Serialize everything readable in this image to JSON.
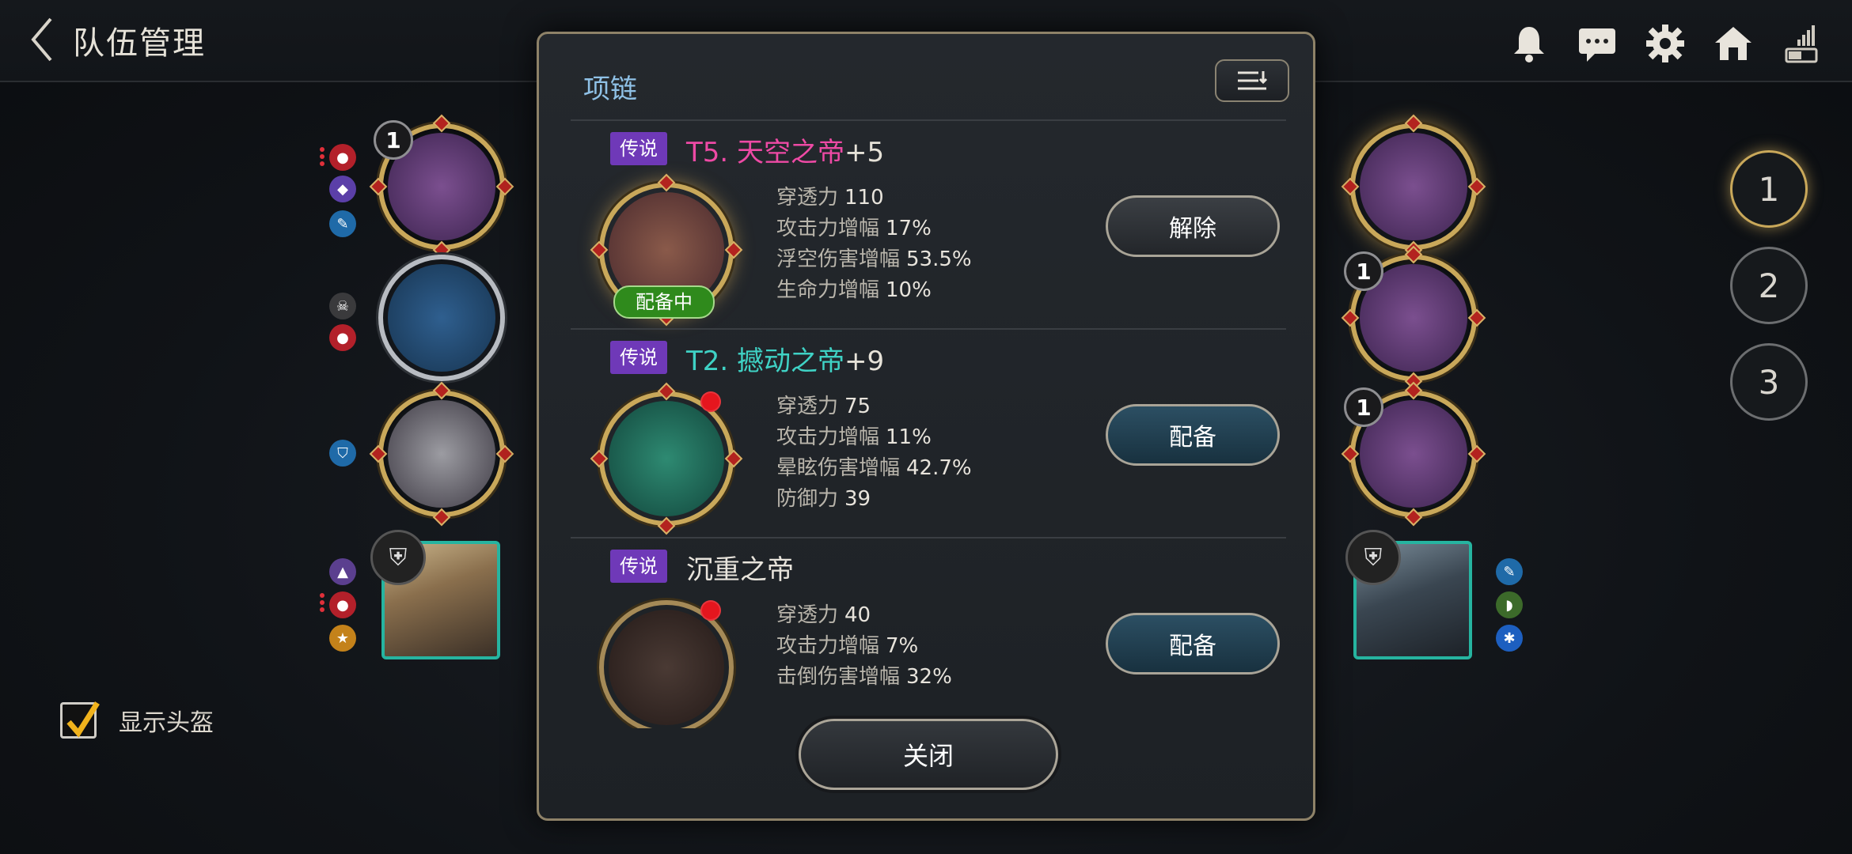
{
  "header": {
    "title": "队伍管理"
  },
  "left_heroes": {
    "slot1_count": "1"
  },
  "right_heroes": {
    "slot2_count": "1",
    "slot3_count": "1"
  },
  "page_tabs": [
    "1",
    "2",
    "3"
  ],
  "show_helmet": {
    "label": "显示头盔",
    "checked": true
  },
  "modal": {
    "title": "项链",
    "items": [
      {
        "rarity": "传说",
        "name": "T5. 天空之帝",
        "plus": "+5",
        "name_color": "#ee4aa5",
        "equipped_tag": "配备中",
        "stats": [
          {
            "label": "穿透力",
            "value": "110"
          },
          {
            "label": "攻击力增幅",
            "value": "17%"
          },
          {
            "label": "浮空伤害增幅",
            "value": "53.5%"
          },
          {
            "label": "生命力增幅",
            "value": "10%"
          }
        ],
        "action": "解除"
      },
      {
        "rarity": "传说",
        "name": "T2. 撼动之帝",
        "plus": "+9",
        "name_color": "#3fd2c5",
        "stats": [
          {
            "label": "穿透力",
            "value": "75"
          },
          {
            "label": "攻击力增幅",
            "value": "11%"
          },
          {
            "label": "晕眩伤害增幅",
            "value": "42.7%"
          },
          {
            "label": "防御力",
            "value": "39"
          }
        ],
        "action": "配备"
      },
      {
        "rarity": "传说",
        "name": "沉重之帝",
        "plus": "",
        "name_color": "#e8e4dc",
        "stats": [
          {
            "label": "穿透力",
            "value": "40"
          },
          {
            "label": "攻击力增幅",
            "value": "7%"
          },
          {
            "label": "击倒伤害增幅",
            "value": "32%"
          }
        ],
        "action": "配备"
      }
    ],
    "close_label": "关闭"
  },
  "colors": {
    "accent_gold": "#c9a85a",
    "rarity_legend": "#6f39b8",
    "equipped_green": "#2f8a1c",
    "title_blue": "#8fc1e6"
  }
}
